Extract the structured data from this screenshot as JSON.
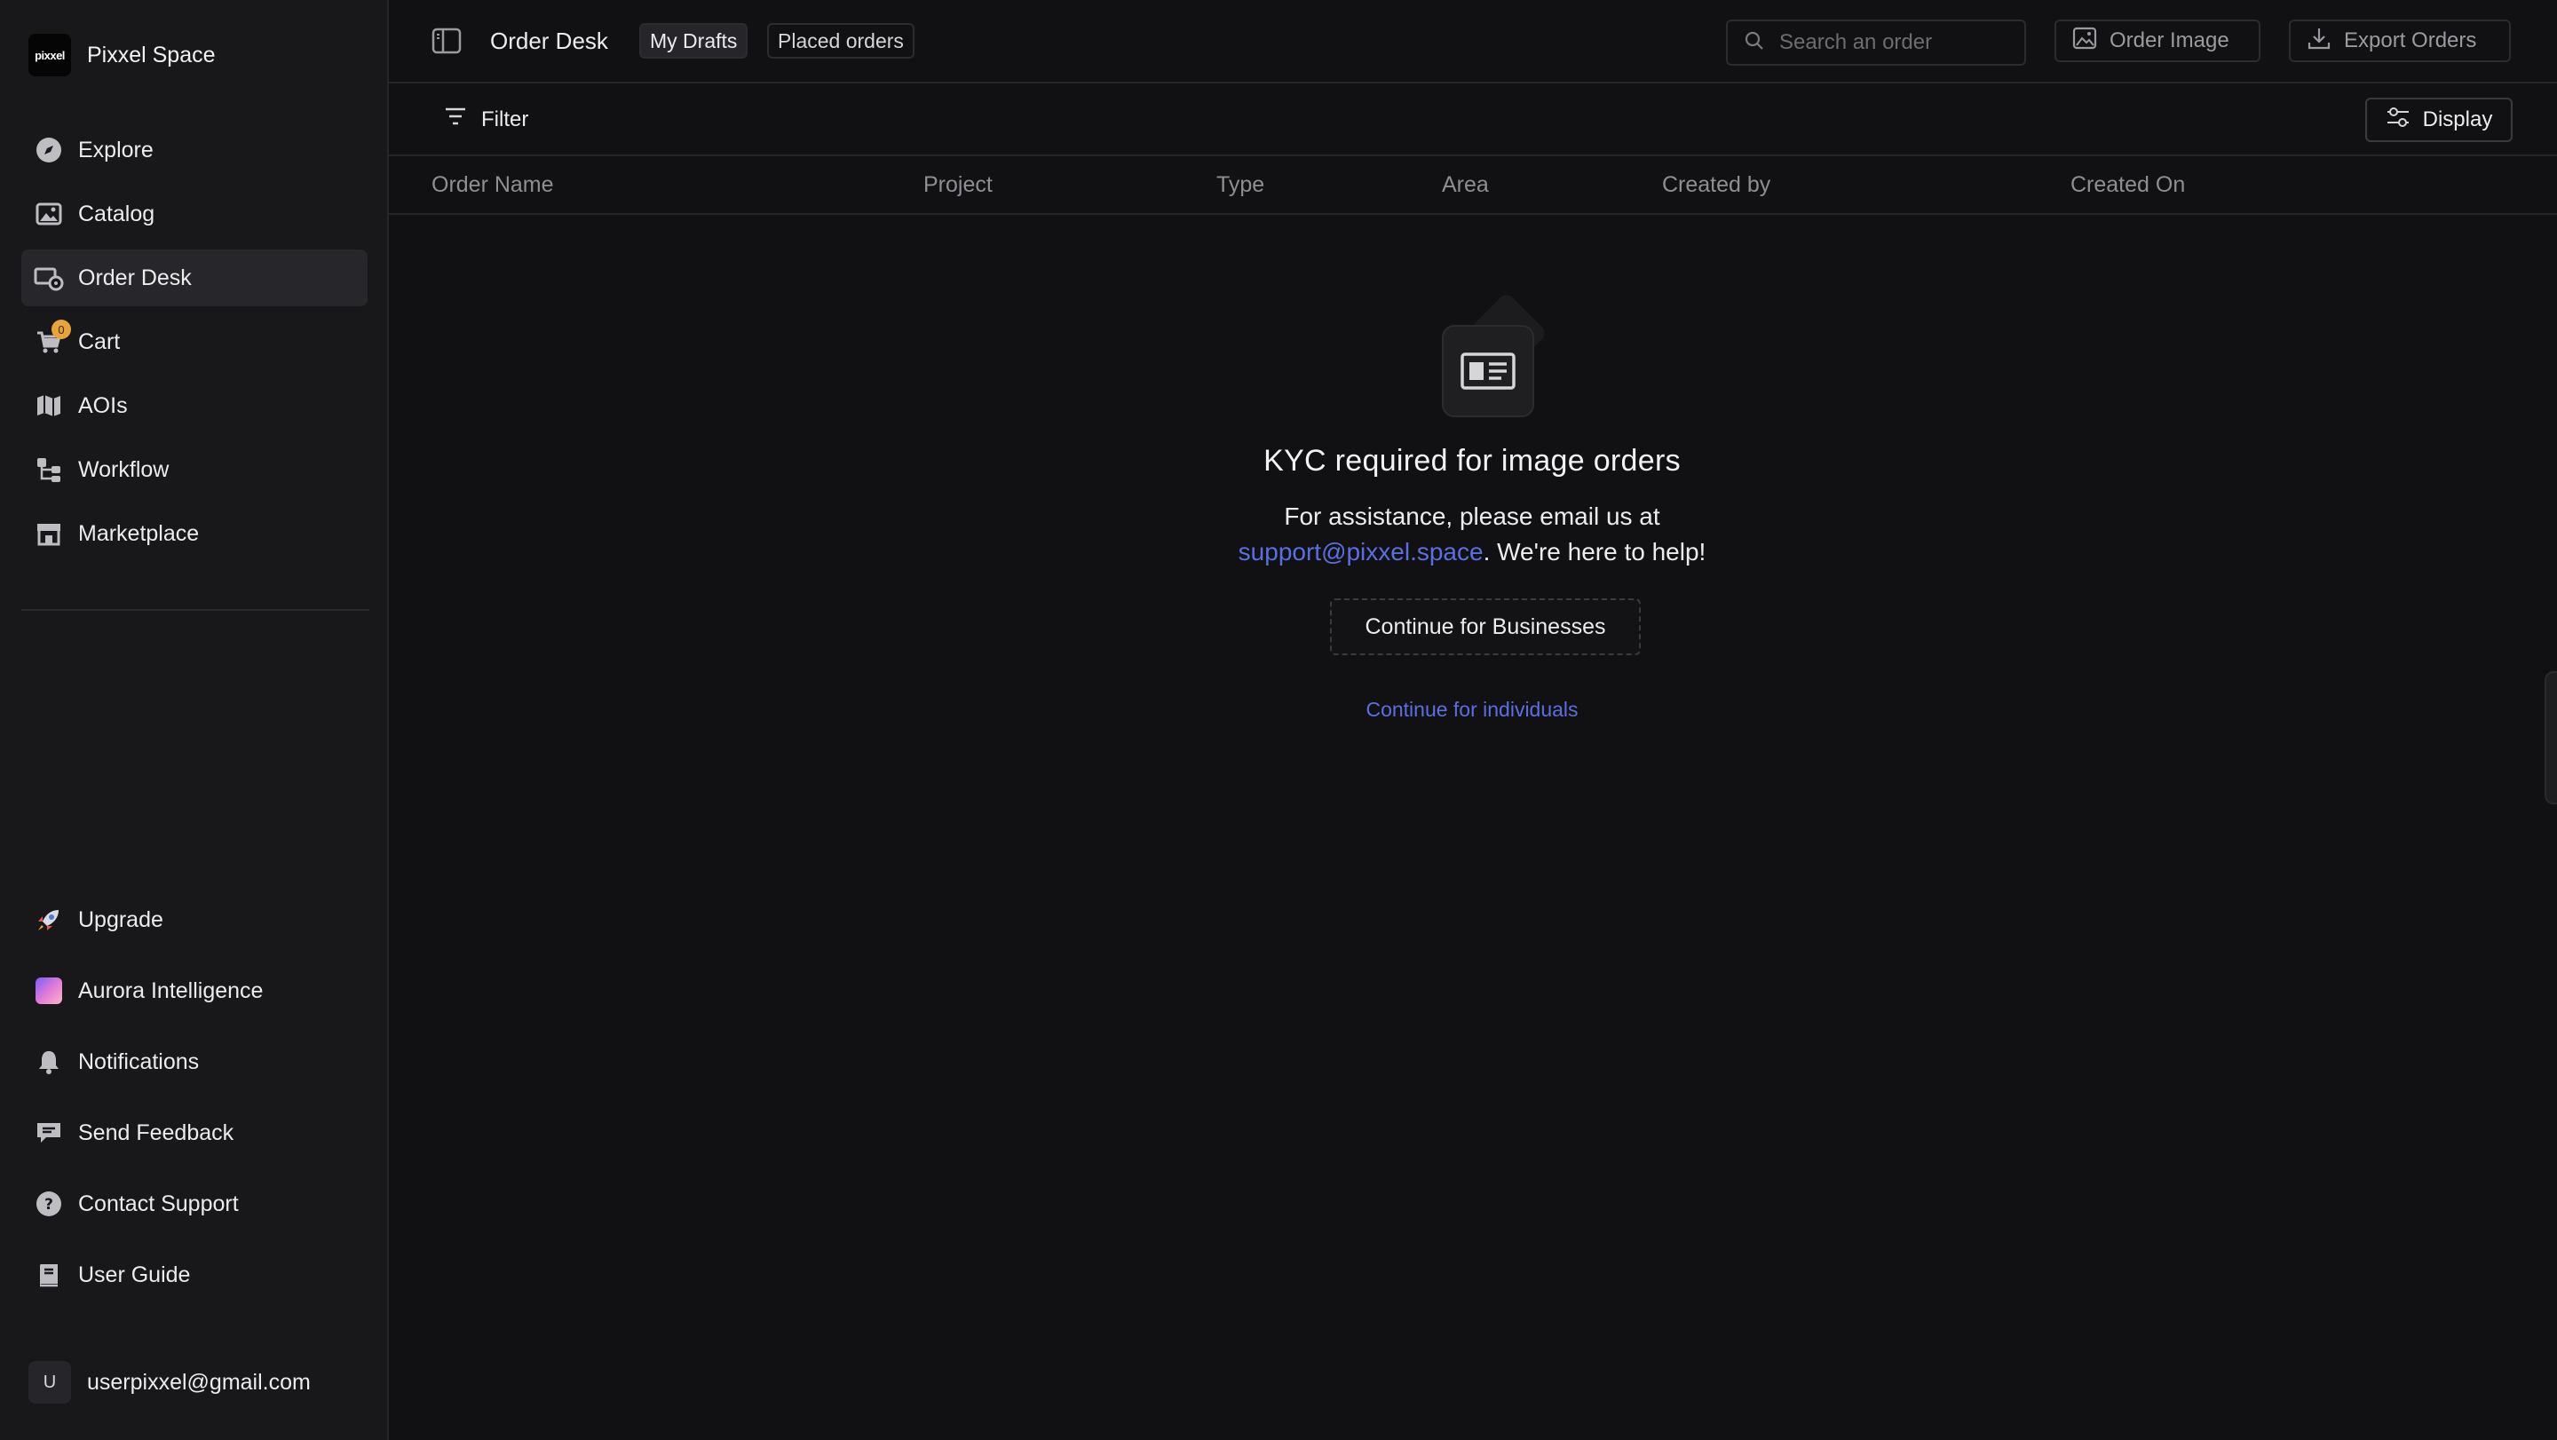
{
  "brand": {
    "logo_text": "pixxel",
    "name": "Pixxel Space"
  },
  "sidebar": {
    "items": [
      {
        "label": "Explore",
        "icon": "compass-icon"
      },
      {
        "label": "Catalog",
        "icon": "images-icon"
      },
      {
        "label": "Order Desk",
        "icon": "order-desk-icon",
        "active": true
      },
      {
        "label": "Cart",
        "icon": "cart-icon",
        "badge": "0"
      },
      {
        "label": "AOIs",
        "icon": "map-icon"
      },
      {
        "label": "Workflow",
        "icon": "workflow-icon"
      },
      {
        "label": "Marketplace",
        "icon": "store-icon"
      }
    ],
    "bottom_items": [
      {
        "label": "Upgrade",
        "icon": "rocket-icon"
      },
      {
        "label": "Aurora Intelligence",
        "icon": "aurora-icon"
      },
      {
        "label": "Notifications",
        "icon": "bell-icon"
      },
      {
        "label": "Send Feedback",
        "icon": "feedback-icon"
      },
      {
        "label": "Contact Support",
        "icon": "help-icon"
      },
      {
        "label": "User Guide",
        "icon": "book-icon"
      }
    ],
    "user": {
      "initial": "U",
      "email": "userpixxel@gmail.com"
    }
  },
  "topbar": {
    "breadcrumb": "Order Desk",
    "tabs": [
      {
        "label": "My Drafts",
        "active": true
      },
      {
        "label": "Placed orders",
        "active": false
      }
    ],
    "search_placeholder": "Search an order",
    "order_image_label": "Order Image",
    "export_label": "Export Orders"
  },
  "filterbar": {
    "filter_label": "Filter",
    "display_label": "Display"
  },
  "table": {
    "columns": [
      "Order Name",
      "Project",
      "Type",
      "Area",
      "Created by",
      "Created On"
    ]
  },
  "empty_state": {
    "title": "KYC required for image orders",
    "line1": "For assistance, please email us at",
    "email": "support@pixxel.space",
    "line2_suffix": ". We're here to help!",
    "business_button": "Continue for Businesses",
    "individuals_link": "Continue for individuals"
  },
  "colors": {
    "accent": "#5a6fe0",
    "badge": "#e8a33a",
    "background": "#111113",
    "sidebar": "#18181b"
  }
}
